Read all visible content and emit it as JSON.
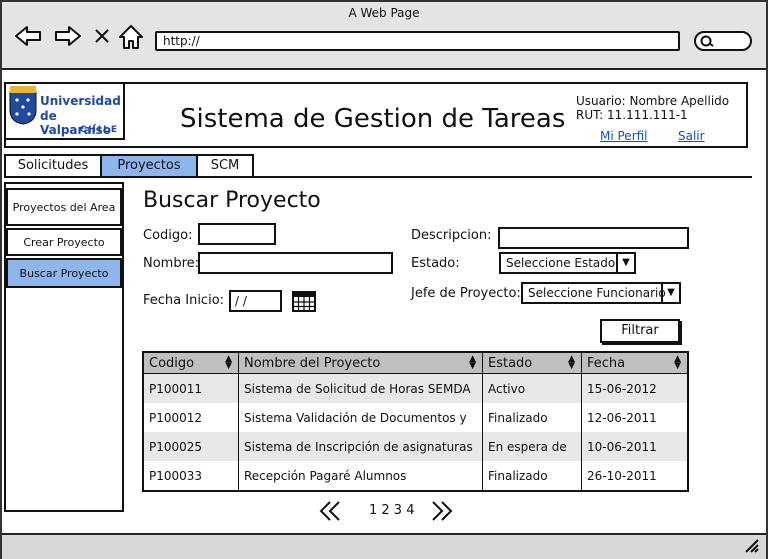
{
  "browser": {
    "title": "A Web Page",
    "url": "http://"
  },
  "logo": {
    "line1": "Universidad",
    "line2": "de Valparaíso",
    "line3": "CHILE"
  },
  "header": {
    "title": "Sistema de Gestion de Tareas",
    "user_label": "Usuario: Nombre Apellido",
    "rut": "RUT: 11.111.111-1",
    "profile_link": "Mi Perfil",
    "logout_link": "Salir"
  },
  "tabs": [
    {
      "label": "Solicitudes"
    },
    {
      "label": "Proyectos"
    },
    {
      "label": "SCM"
    }
  ],
  "sidebar": {
    "items": [
      {
        "label": "Proyectos del Area"
      },
      {
        "label": "Crear Proyecto"
      },
      {
        "label": "Buscar Proyecto"
      }
    ]
  },
  "form": {
    "title": "Buscar Proyecto",
    "codigo_label": "Codigo:",
    "nombre_label": "Nombre:",
    "fecha_label": "Fecha Inicio:",
    "fecha_value": "/ /",
    "descripcion_label": "Descripcion:",
    "estado_label": "Estado:",
    "estado_value": "Seleccione Estado",
    "jefe_label": "Jefe de Proyecto:",
    "jefe_value": "Seleccione Funcionario",
    "filter_button": "Filtrar"
  },
  "table": {
    "columns": [
      "Codigo",
      "Nombre del Proyecto",
      "Estado",
      "Fecha"
    ],
    "rows": [
      [
        "P100011",
        "Sistema de Solicitud de Horas SEMDA",
        "Activo",
        "15-06-2012"
      ],
      [
        "P100012",
        "Sistema Validación de Documentos y",
        "Finalizado",
        "12-06-2011"
      ],
      [
        "P100025",
        "Sistema de Inscripción de asignaturas",
        "En espera de",
        "10-06-2011"
      ],
      [
        "P100033",
        "Recepción Pagaré Alumnos",
        "Finalizado",
        "26-10-2011"
      ]
    ]
  },
  "pagination": {
    "pages": "1 2 3 4"
  },
  "colors": {
    "accent": "#8fb6ec",
    "header_bg": "#bfbfbf",
    "row_alt": "#e8e8e8"
  }
}
